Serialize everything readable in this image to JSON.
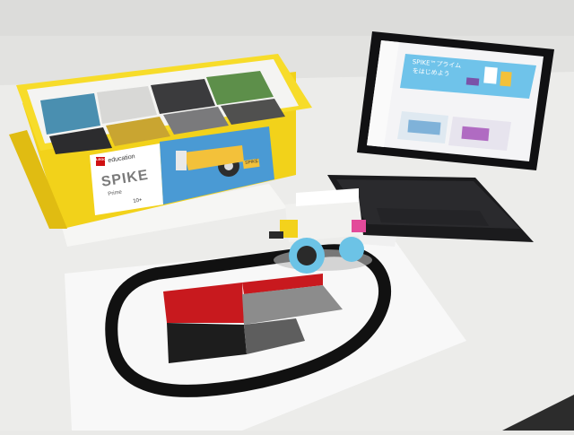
{
  "photo": {
    "lego_box": {
      "brand": "LEGO",
      "line": "education",
      "product": "SPIKE",
      "variant": "Prime",
      "age": "10+",
      "side_label": "SPIKE"
    },
    "laptop": {
      "banner_title": "SPIKE™プライム",
      "banner_subtitle": "をはじめよう"
    },
    "colors": {
      "box_yellow": "#f2d21a",
      "tray_white": "#f4f4f2",
      "mat_black": "#111111",
      "mat_red": "#c8191e",
      "hub_blue": "#6cc3e6",
      "screen_banner": "#6fc3ea"
    },
    "icons": [
      "lego-logo",
      "robot-car"
    ]
  }
}
